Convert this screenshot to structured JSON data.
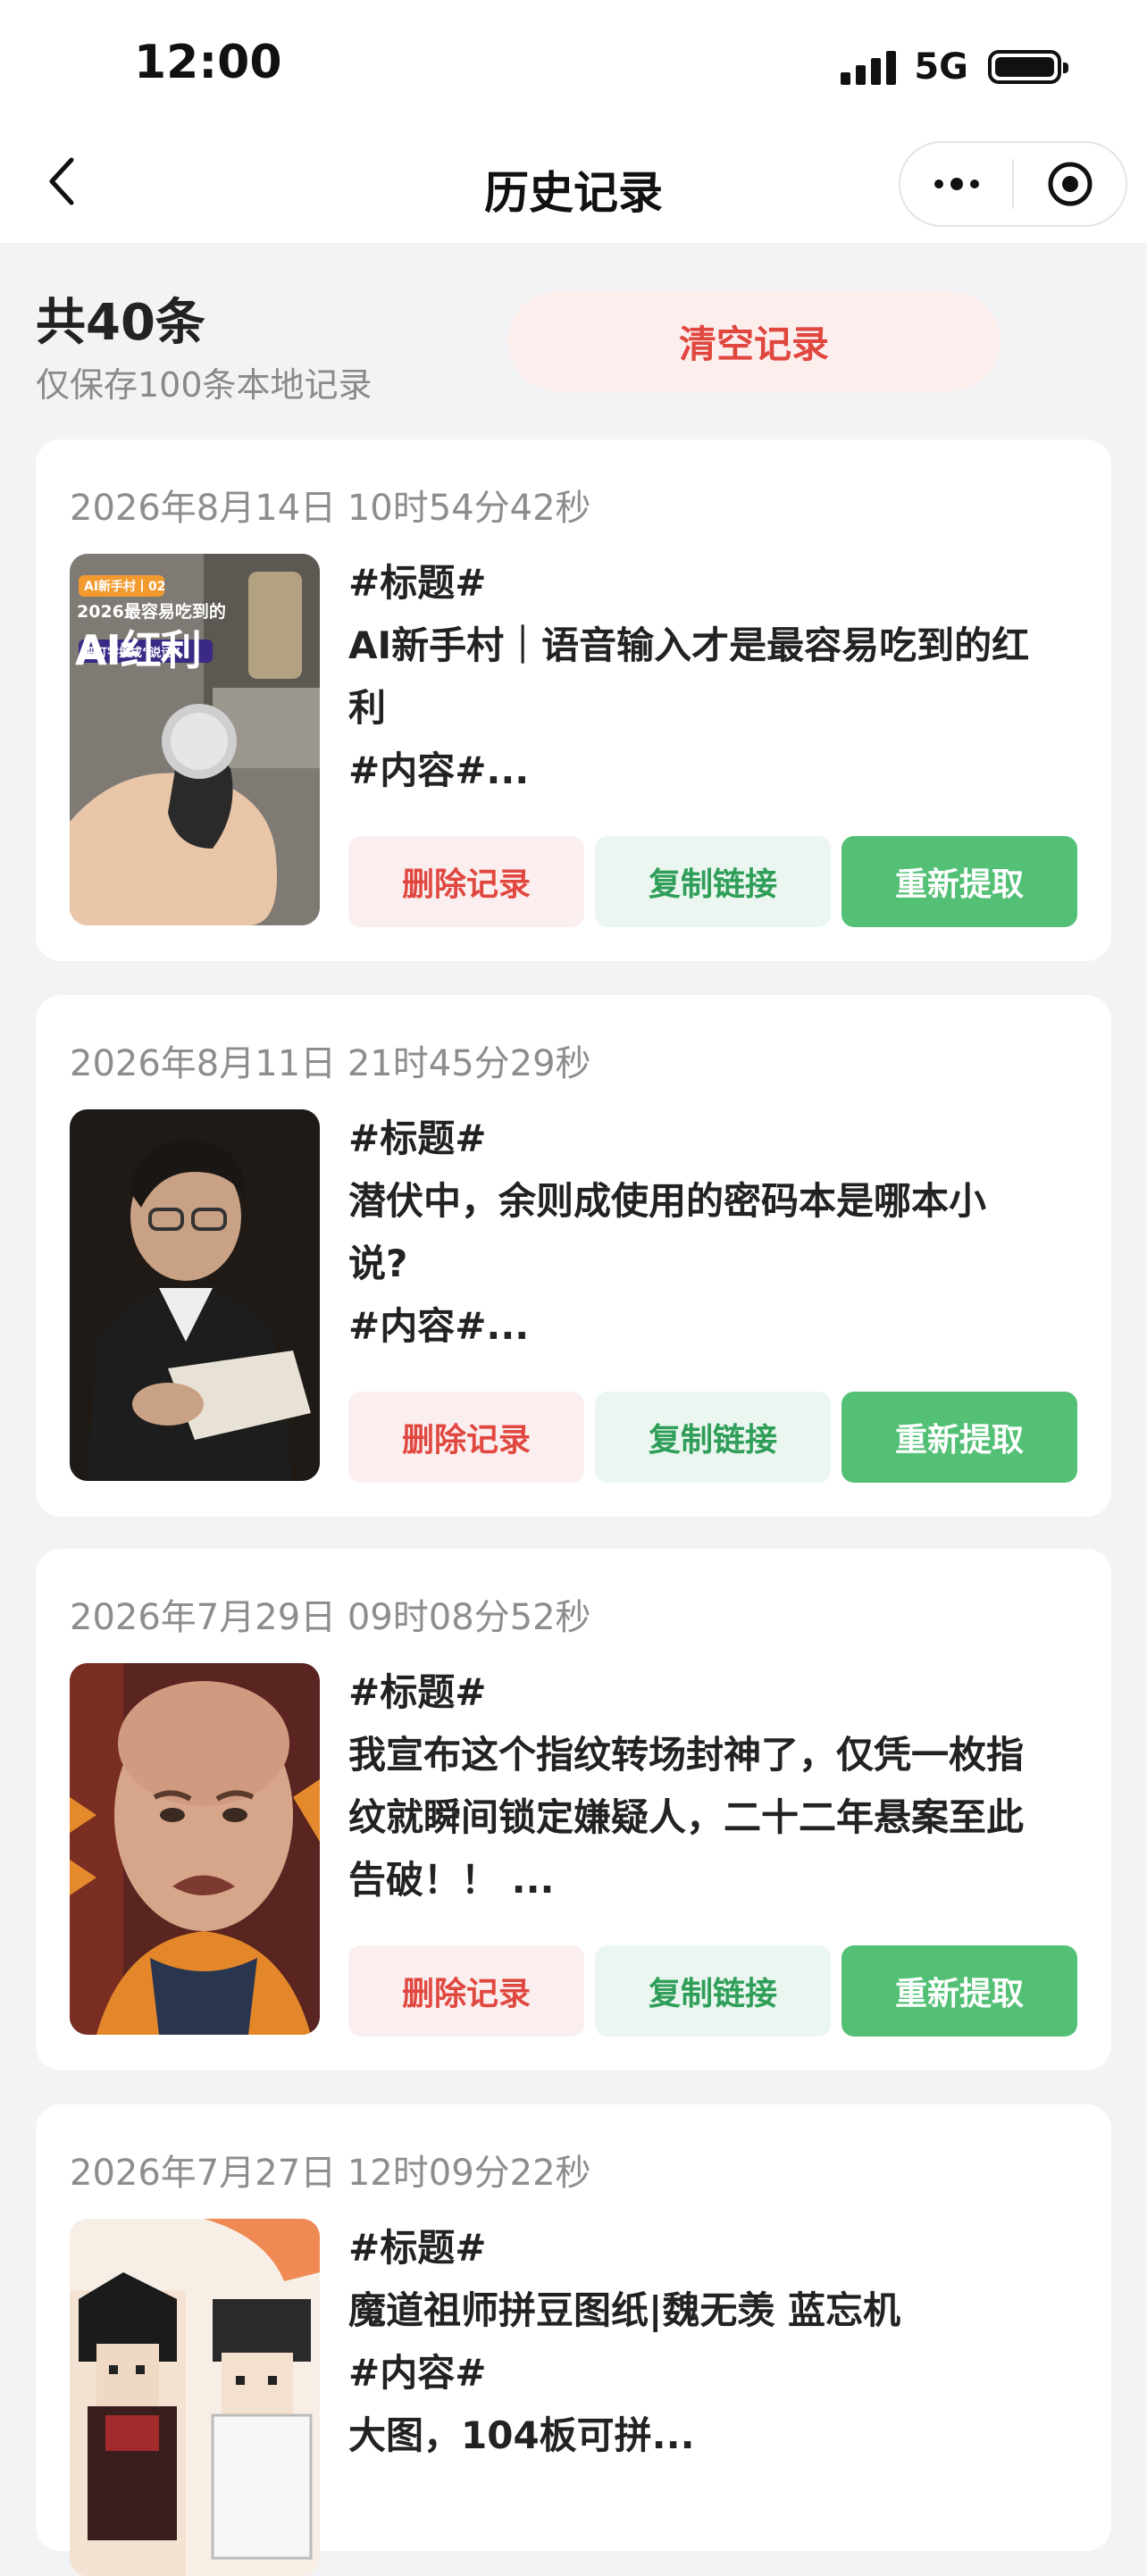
{
  "status_bar": {
    "time": "12:00",
    "network": "5G"
  },
  "nav": {
    "title": "历史记录",
    "more_icon": "more-dots-icon",
    "target_icon": "target-icon",
    "back_icon": "chevron-left-icon"
  },
  "summary": {
    "count_text": "共40条",
    "note": "仅保存100条本地记录",
    "clear_label": "清空记录"
  },
  "records": [
    {
      "date": "2026年8月14日 10时54分42秒",
      "lines": [
        "#标题#",
        "AI新手村｜语音输入才是最容易吃到的红",
        "利",
        "#内容#..."
      ],
      "thumb": {
        "tag": "AI新手村丨02",
        "headline": "2026最容易吃到的",
        "big": "AI红利",
        "sub": "把打字换成“说话”"
      }
    },
    {
      "date": "2026年8月11日 21时45分29秒",
      "lines": [
        "#标题#",
        "潜伏中，余则成使用的密码本是哪本小",
        "说?",
        "#内容#..."
      ]
    },
    {
      "date": "2026年7月29日 09时08分52秒",
      "lines": [
        "#标题#",
        "我宣布这个指纹转场封神了，仅凭一枚指",
        "纹就瞬间锁定嫌疑人，二十二年悬案至此",
        "告破！！ ..."
      ]
    },
    {
      "date": "2026年7月27日 12时09分22秒",
      "lines": [
        "#标题#",
        "魔道祖师拼豆图纸|魏无羡 蓝忘机",
        "#内容#",
        "大图，104板可拼..."
      ]
    }
  ],
  "buttons": {
    "delete": "删除记录",
    "copy": "复制链接",
    "refetch": "重新提取"
  },
  "colors": {
    "accent_green": "#53c075",
    "danger_red": "#e0473f",
    "background": "#f2f3f5"
  }
}
